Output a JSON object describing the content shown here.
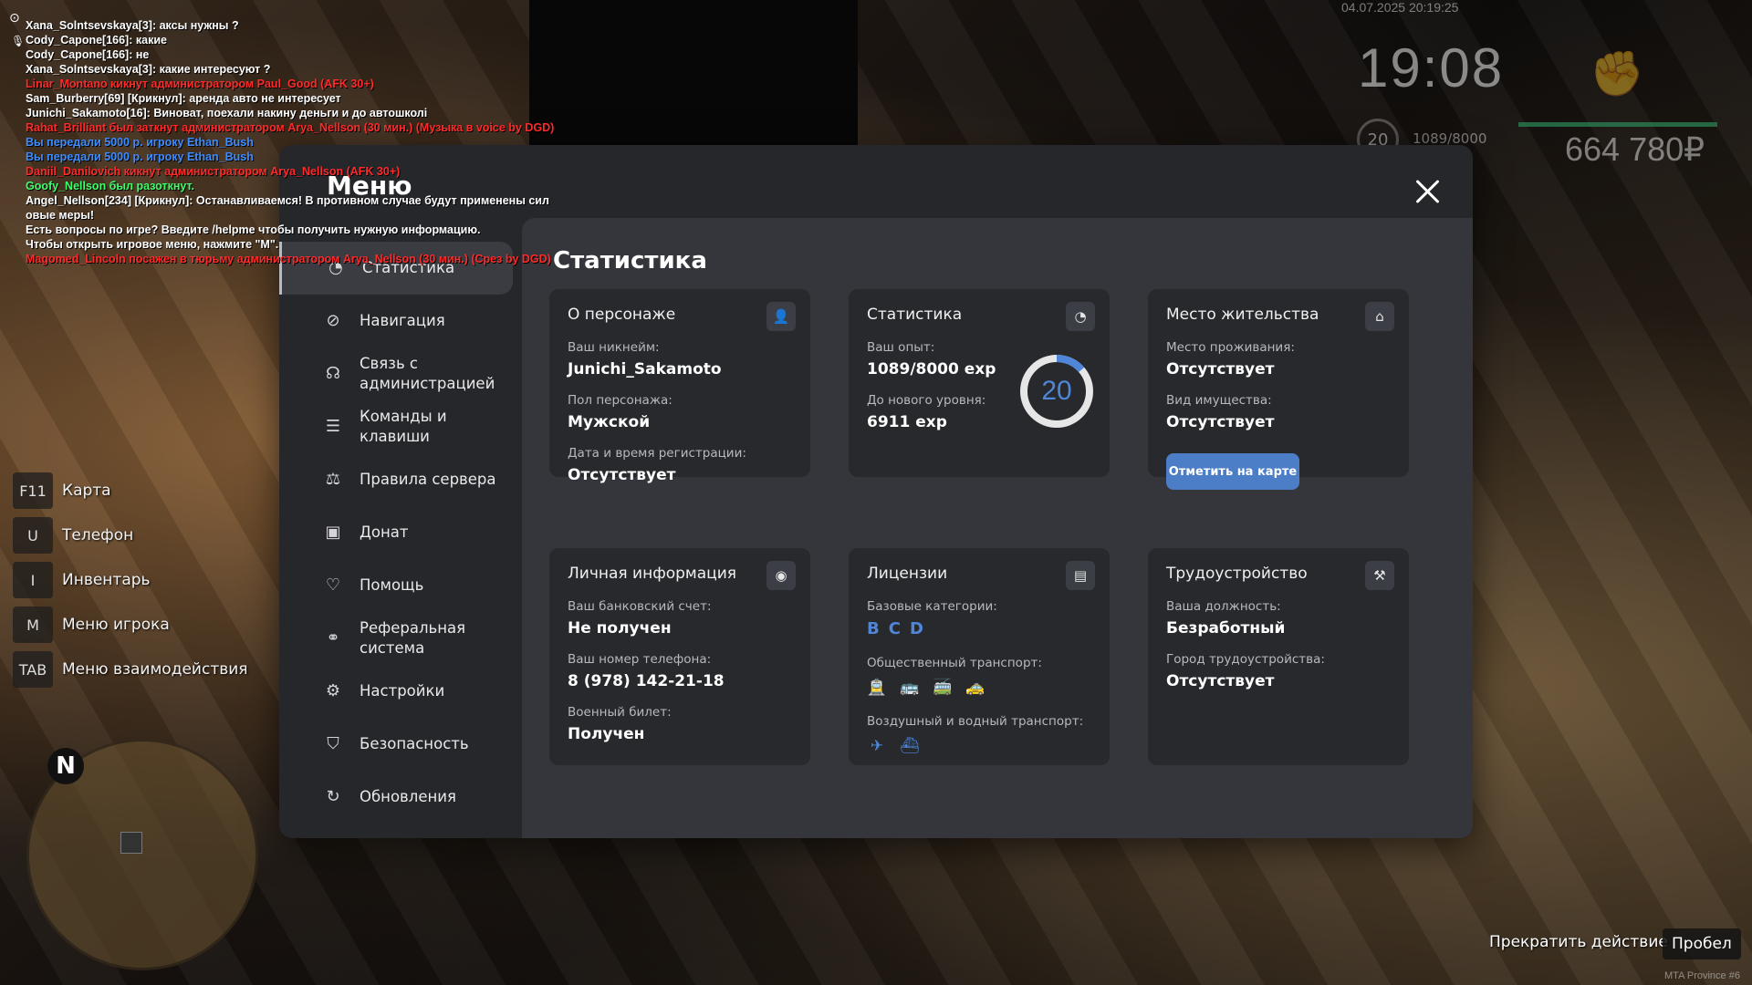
{
  "chat": [
    {
      "text": "Xana_Solntsevskaya[3]: аксы нужны ?",
      "color": "#ffffff"
    },
    {
      "text": "Cody_Capone[166]: какие",
      "color": "#ffffff"
    },
    {
      "text": "Cody_Capone[166]: не",
      "color": "#ffffff"
    },
    {
      "text": "Xana_Solntsevskaya[3]: какие интересуют ?",
      "color": "#ffffff"
    },
    {
      "text": "Linar_Montano кикнут администратором Paul_Good (AFK 30+)",
      "color": "#ff2a2a"
    },
    {
      "text": "Sam_Burberry[69] [Крикнул]: аренда авто не интересует",
      "color": "#ffffff"
    },
    {
      "text": "Junichi_Sakamoto[16]: Виноват, поехали накину деньги и до автошколі",
      "color": "#ffffff"
    },
    {
      "text": "Rahat_Brilliant был заткнут администратором Arya_Nellson (30 мин.) (Музыка в voice by DGD)",
      "color": "#ff2a2a"
    },
    {
      "text": "Вы передали 5000 р. игроку Ethan_Bush",
      "color": "#3d8dff"
    },
    {
      "text": "Вы передали 5000 р. игроку Ethan_Bush",
      "color": "#3d8dff"
    },
    {
      "text": "Daniil_Danilovich кикнут администратором Arya_Nellson (AFK 30+)",
      "color": "#ff2a2a"
    },
    {
      "text": "Goofy_Nellson был разоткнут.",
      "color": "#3dff6a"
    },
    {
      "text": "Angel_Nellson[234] [Крикнул]: Останавливаемся! В противном случае будут применены сил",
      "color": "#ffffff"
    },
    {
      "text": "овые меры!",
      "color": "#ffffff"
    },
    {
      "text": "Есть вопросы по игре? Введите /helpme чтобы получить нужную информацию.",
      "color": "#ffffff"
    },
    {
      "text": "Чтобы открыть игровое меню, нажмите \"M\".",
      "color": "#ffffff"
    },
    {
      "text": "Magomed_Lincoln посажен в тюрьму администратором Arya_Nellson (30 мин.) (Срез by DGD)",
      "color": "#ff2a2a"
    }
  ],
  "hud": {
    "datetime": "04.07.2025 20:19:25",
    "time": "19:08",
    "level": "20",
    "exp": "1089/8000",
    "money": "664 780₽",
    "fist_icon": "fist-icon"
  },
  "hotkeys": [
    {
      "key": "F11",
      "label": "Карта"
    },
    {
      "key": "U",
      "label": "Телефон"
    },
    {
      "key": "I",
      "label": "Инвентарь"
    },
    {
      "key": "M",
      "label": "Меню игрока"
    },
    {
      "key": "TAB",
      "label": "Меню взаимодействия"
    }
  ],
  "minimap": {
    "north": "N"
  },
  "prompt": {
    "action": "Прекратить действие",
    "key": "Пробел"
  },
  "watermark": "MTA Province #6",
  "menu": {
    "title": "Меню",
    "nav": [
      {
        "label": "Статистика",
        "icon": "chart-icon",
        "active": true
      },
      {
        "label": "Навигация",
        "icon": "compass-icon"
      },
      {
        "label": "Связь с администрацией",
        "icon": "headset-icon"
      },
      {
        "label": "Команды и клавиши",
        "icon": "list-icon"
      },
      {
        "label": "Правила сервера",
        "icon": "scales-icon"
      },
      {
        "label": "Донат",
        "icon": "wallet-icon"
      },
      {
        "label": "Помощь",
        "icon": "heart-hand-icon"
      },
      {
        "label": "Реферальная система",
        "icon": "referral-icon"
      },
      {
        "label": "Настройки",
        "icon": "gear-icon"
      },
      {
        "label": "Безопасность",
        "icon": "shield-icon"
      },
      {
        "label": "Обновления",
        "icon": "refresh-icon"
      }
    ],
    "content_title": "Статистика",
    "cards": {
      "character": {
        "title": "О персонаже",
        "nickname_label": "Ваш никнейм:",
        "nickname": "Junichi_Sakamoto",
        "gender_label": "Пол персонажа:",
        "gender": "Мужской",
        "reg_label": "Дата и время регистрации:",
        "reg": "Отсутствует"
      },
      "stats": {
        "title": "Статистика",
        "exp_label": "Ваш опыт:",
        "exp": "1089/8000 exp",
        "next_label": "До нового уровня:",
        "next": "6911 exp",
        "level": "20",
        "progress": 0.136
      },
      "residence": {
        "title": "Место жительства",
        "place_label": "Место проживания:",
        "place": "Отсутствует",
        "property_label": "Вид имущества:",
        "property": "Отсутствует",
        "button": "Отметить на карте"
      },
      "personal": {
        "title": "Личная информация",
        "bank_label": "Ваш банковский счет:",
        "bank": "Не получен",
        "phone_label": "Ваш номер телефона:",
        "phone": "8 (978) 142-21-18",
        "military_label": "Военный билет:",
        "military": "Получен"
      },
      "licenses": {
        "title": "Лицензии",
        "base_label": "Базовые категории:",
        "base": [
          "B",
          "C",
          "D"
        ],
        "public_label": "Общественный транспорт:",
        "public_icons": [
          "tram-icon",
          "bus-icon",
          "trolleybus-icon",
          "taxi-icon"
        ],
        "air_label": "Воздушный и водный транспорт:",
        "air_icons": [
          "plane-icon",
          "boat-icon"
        ]
      },
      "employment": {
        "title": "Трудоустройство",
        "position_label": "Ваша должность:",
        "position": "Безработный",
        "city_label": "Город трудоустройства:",
        "city": "Отсутствует"
      }
    }
  }
}
